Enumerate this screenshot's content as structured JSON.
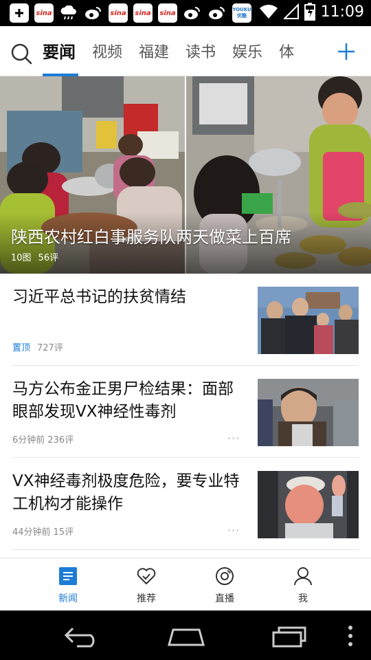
{
  "status_bar": {
    "time": "11:09",
    "notifications": [
      "add-box-icon",
      "sina-icon",
      "cloud-icon",
      "weibo-icon",
      "sina-icon",
      "sina-icon",
      "sina-icon",
      "weibo-icon",
      "weibo-icon",
      "youku-icon"
    ],
    "sina_text": "sina",
    "youku_text": "YOUKU\n优酷"
  },
  "tabs": {
    "items": [
      "要闻",
      "视频",
      "福建",
      "读书",
      "娱乐",
      "体"
    ],
    "active_index": 0
  },
  "hero": {
    "title": "陕西农村红白事服务队两天做菜上百席",
    "photo_count": "10图",
    "comment_count": "56评"
  },
  "news": [
    {
      "title": "习近平总书记的扶贫情结",
      "pinned_label": "置顶",
      "comments": "727评",
      "time": ""
    },
    {
      "title": "马方公布金正男尸检结果：面部眼部发现VX神经性毒剂",
      "time": "6分钟前",
      "comments": "236评",
      "more": "···"
    },
    {
      "title": "VX神经毒剂极度危险，要专业特工机构才能操作",
      "time": "44分钟前",
      "comments": "15评",
      "more": "···"
    }
  ],
  "bottom_nav": [
    {
      "label": "新闻",
      "icon": "news-icon",
      "active": true
    },
    {
      "label": "推荐",
      "icon": "heart-check-icon",
      "active": false
    },
    {
      "label": "直播",
      "icon": "live-icon",
      "active": false
    },
    {
      "label": "我",
      "icon": "person-icon",
      "active": false
    }
  ],
  "colors": {
    "accent": "#1c7cd6",
    "status_bar": "#000000"
  }
}
